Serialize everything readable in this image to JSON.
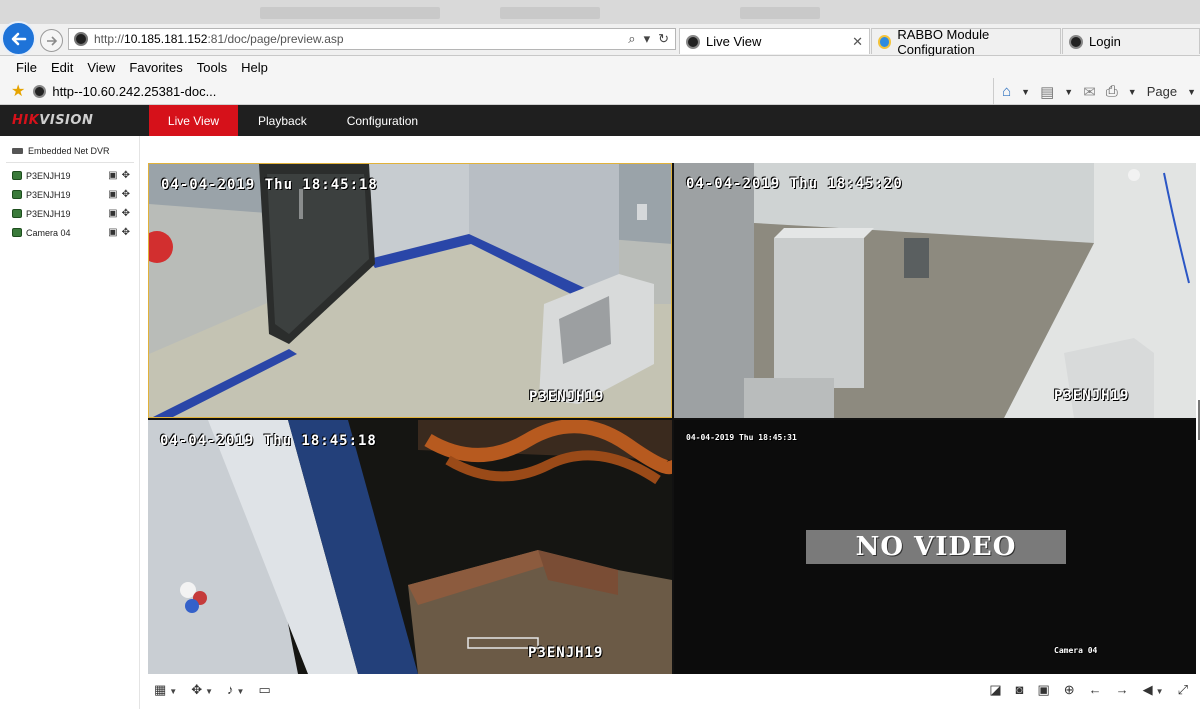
{
  "browser": {
    "url_prefix": "http://",
    "url_host": "10.185.181.152",
    "url_rest": ":81/doc/page/preview.asp",
    "url_tools": {
      "search": "⌕",
      "dropdown": "▾",
      "refresh": "↻"
    },
    "tabs": [
      {
        "label": "Live View",
        "close": "✕",
        "active": true,
        "icon": "webcam-icon"
      },
      {
        "label": "RABBO Module Configuration",
        "active": false,
        "icon": "ie-icon"
      },
      {
        "label": "Login",
        "active": false,
        "icon": "webcam-icon"
      }
    ],
    "menu": [
      "File",
      "Edit",
      "View",
      "Favorites",
      "Tools",
      "Help"
    ],
    "favorite": "http--10.60.242.25381-doc...",
    "command_bar": {
      "page_label": "Page"
    }
  },
  "app": {
    "logo_hik": "HIK",
    "logo_vision": "VISION",
    "nav": [
      "Live View",
      "Playback",
      "Configuration"
    ],
    "active_nav": "Live View"
  },
  "device_tree": {
    "device_name": "Embedded Net DVR",
    "cameras": [
      {
        "name": "P3ENJH19"
      },
      {
        "name": "P3ENJH19"
      },
      {
        "name": "P3ENJH19"
      },
      {
        "name": "Camera 04"
      }
    ]
  },
  "video_tiles": [
    {
      "timestamp": "04-04-2019 Thu 18:45:18",
      "camera_label": "P3ENJH19",
      "selected": true
    },
    {
      "timestamp": "04-04-2019 Thu 18:45:20",
      "camera_label": "P3ENJH19",
      "selected": false
    },
    {
      "timestamp": "04-04-2019 Thu 18:45:18",
      "camera_label": "P3ENJH19",
      "selected": false
    },
    {
      "timestamp": "04-04-2019 Thu 18:45:31",
      "camera_label": "Camera 04",
      "no_video_text": "NO VIDEO",
      "selected": false
    }
  ],
  "colors": {
    "brand_red": "#d6111a",
    "header_bg": "#1f1f1f",
    "selected_border": "#e1b23a",
    "ie_blue": "#1e73d8"
  },
  "toolbar_icons": {
    "left": [
      "layout-grid-icon",
      "ptz-icon",
      "microphone-icon",
      "screen-icon"
    ],
    "right": [
      "stop-all-icon",
      "snapshot-icon",
      "record-icon",
      "zoom-icon",
      "prev-page-icon",
      "next-page-icon",
      "volume-muted-icon",
      "fullscreen-icon"
    ]
  }
}
